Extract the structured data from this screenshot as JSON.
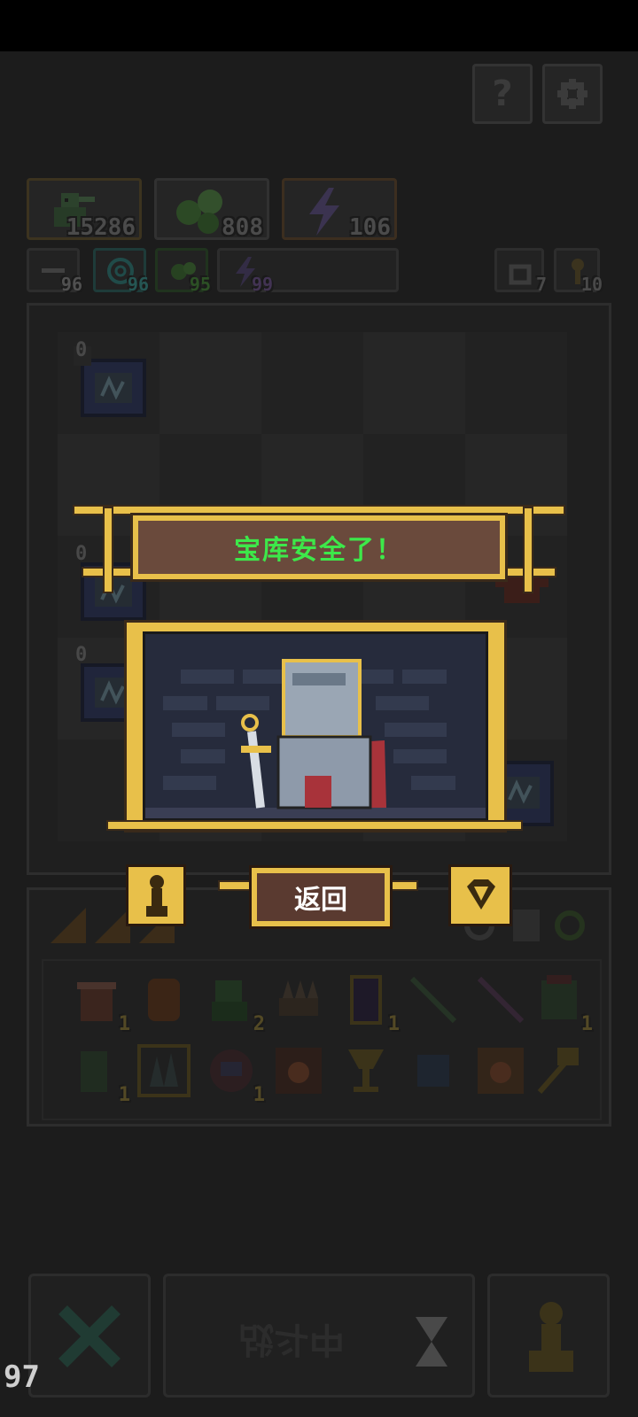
{
  "top_buttons": {
    "help_icon": "?",
    "settings_icon": "gear-icon"
  },
  "resources": [
    {
      "name": "goblin",
      "value": "15286"
    },
    {
      "name": "slime",
      "value": "808"
    },
    {
      "name": "energy",
      "value": "106"
    }
  ],
  "mini_stats": [
    {
      "value": "96",
      "color": "#9a9a9a"
    },
    {
      "value": "96",
      "color": "#3aa7a0"
    },
    {
      "value": "95",
      "color": "#4a9a3a"
    },
    {
      "value": "99",
      "color": "#7a5aa0"
    }
  ],
  "right_stats": [
    {
      "icon": "recycle-icon",
      "value": "7"
    },
    {
      "icon": "key-icon",
      "value": "10"
    }
  ],
  "board_badges": [
    "0",
    "0",
    "0"
  ],
  "dialog": {
    "title": "宝库安全了！",
    "back_label": "返回"
  },
  "inventory": {
    "counts": [
      "1",
      "",
      "2",
      "",
      "1",
      "",
      "",
      "1",
      "1",
      "",
      "1",
      "",
      "",
      "",
      "",
      ""
    ]
  },
  "bottom": {
    "battle_label": "战斗中",
    "fps": "97"
  },
  "colors": {
    "gold": "#e8c04a",
    "banner_text": "#3de84a",
    "banner_bg": "#6a4a3c"
  }
}
